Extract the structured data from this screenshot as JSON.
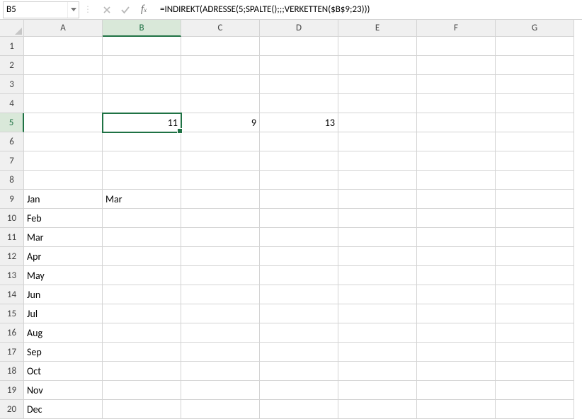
{
  "name_box": "B5",
  "formula": "=INDIREKT(ADRESSE(5;SPALTE();;;VERKETTEN($B$9;23)))",
  "columns": [
    "A",
    "B",
    "C",
    "D",
    "E",
    "F",
    "G"
  ],
  "rows": [
    "1",
    "2",
    "3",
    "4",
    "5",
    "6",
    "7",
    "8",
    "9",
    "10",
    "11",
    "12",
    "13",
    "14",
    "15",
    "16",
    "17",
    "18",
    "19",
    "20"
  ],
  "selected_cell": {
    "col": "B",
    "row": "5"
  },
  "cells": {
    "B5": {
      "value": "11",
      "type": "num"
    },
    "C5": {
      "value": "9",
      "type": "num"
    },
    "D5": {
      "value": "13",
      "type": "num"
    },
    "A9": {
      "value": "Jan",
      "type": "text"
    },
    "B9": {
      "value": "Mar",
      "type": "text"
    },
    "A10": {
      "value": "Feb",
      "type": "text"
    },
    "A11": {
      "value": "Mar",
      "type": "text"
    },
    "A12": {
      "value": "Apr",
      "type": "text"
    },
    "A13": {
      "value": "May",
      "type": "text"
    },
    "A14": {
      "value": "Jun",
      "type": "text"
    },
    "A15": {
      "value": "Jul",
      "type": "text"
    },
    "A16": {
      "value": "Aug",
      "type": "text"
    },
    "A17": {
      "value": "Sep",
      "type": "text"
    },
    "A18": {
      "value": "Oct",
      "type": "text"
    },
    "A19": {
      "value": "Nov",
      "type": "text"
    },
    "A20": {
      "value": "Dec",
      "type": "text"
    }
  }
}
